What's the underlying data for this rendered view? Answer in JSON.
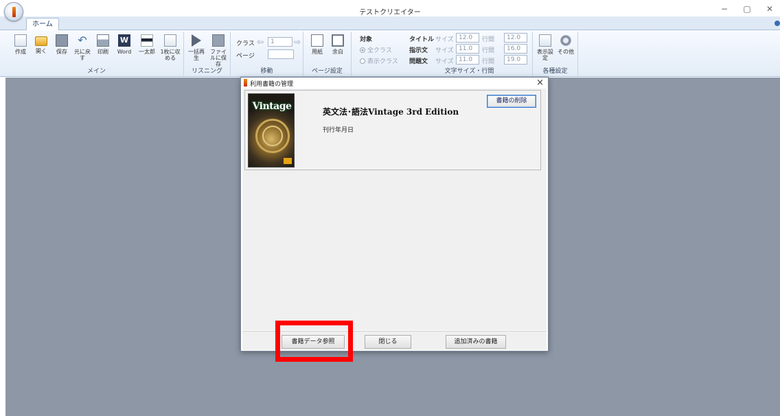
{
  "window": {
    "title": "テストクリエイター",
    "minimize": "−",
    "maximize": "▢",
    "close": "✕"
  },
  "tabs": [
    {
      "label": "ホーム"
    }
  ],
  "ribbon": {
    "main": {
      "label": "メイン",
      "buttons": [
        {
          "label": "作成",
          "icon": "new-doc-icon"
        },
        {
          "label": "開く",
          "icon": "open-folder-icon"
        },
        {
          "label": "保存",
          "icon": "save-icon"
        },
        {
          "label": "元に戻す",
          "icon": "undo-icon"
        },
        {
          "label": "印刷",
          "icon": "print-icon"
        },
        {
          "label": "Word",
          "icon": "word-icon"
        },
        {
          "label": "一太郎",
          "icon": "ichitaro-icon"
        },
        {
          "label": "1枚に収める",
          "icon": "fit-page-icon"
        }
      ]
    },
    "listening": {
      "label": "リスニング",
      "buttons": [
        {
          "label": "一括再生",
          "icon": "play-icon"
        },
        {
          "label": "ファイルに保存",
          "icon": "save-file-icon"
        }
      ]
    },
    "move": {
      "label": "移動",
      "class_label": "クラス",
      "page_label": "ページ",
      "class_value": "1",
      "page_value": ""
    },
    "page_setup": {
      "label": "ページ設定",
      "buttons": [
        {
          "label": "用紙",
          "icon": "paper-icon"
        },
        {
          "label": "余白",
          "icon": "margin-icon"
        }
      ]
    },
    "target": {
      "label": "対象",
      "options": [
        "全クラス",
        "表示クラス"
      ]
    },
    "font_size": {
      "label": "文字サイズ・行間",
      "size_label": "サイズ",
      "spacing_label": "行間",
      "rows": [
        {
          "name": "タイトル",
          "size": "12.0",
          "spacing": "12.0"
        },
        {
          "name": "指示文",
          "size": "11.0",
          "spacing": "16.0"
        },
        {
          "name": "問題文",
          "size": "11.0",
          "spacing": "19.0"
        }
      ]
    },
    "settings": {
      "label": "各種設定",
      "buttons": [
        {
          "label": "表示設定",
          "icon": "display-settings-icon"
        },
        {
          "label": "その他",
          "icon": "gear-icon"
        }
      ]
    }
  },
  "dialog": {
    "title": "利用書籍の管理",
    "book": {
      "cover_text": "Vintage",
      "title": "英文法･語法Vintage 3rd Edition",
      "date_label": "刊行年月日"
    },
    "delete_button": "書籍の削除",
    "footer": {
      "reference_button": "書籍データ参照",
      "close_button": "閉じる",
      "added_books_button": "追加済みの書籍"
    }
  },
  "colors": {
    "highlight": "#ff0000",
    "workspace": "#8d97a6",
    "ribbon": "#e3ecf7"
  }
}
